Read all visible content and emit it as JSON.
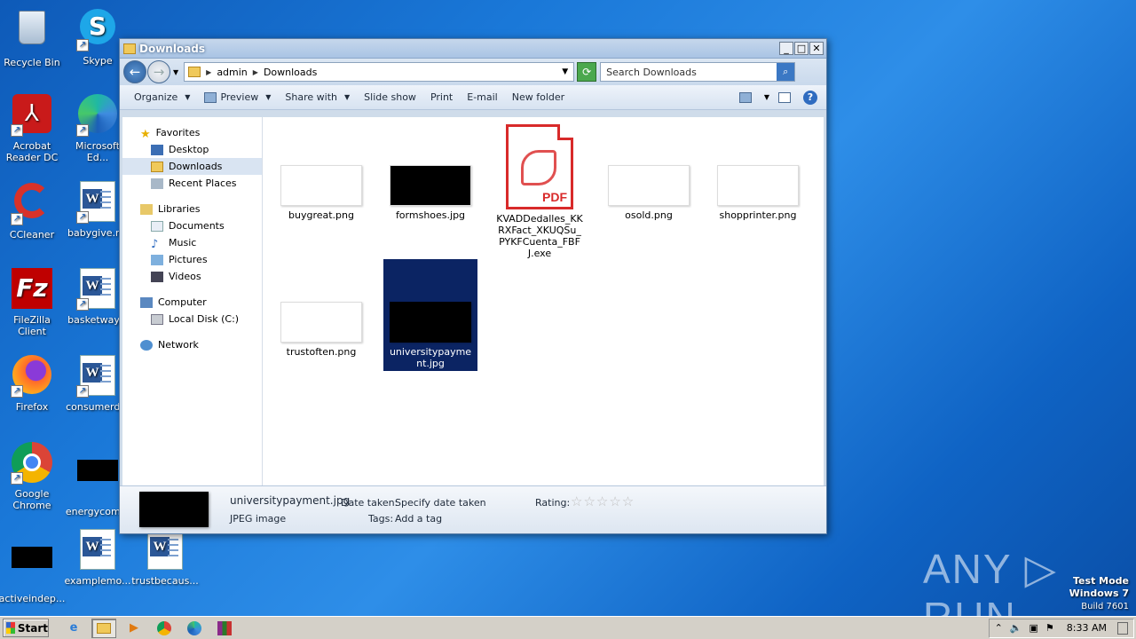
{
  "desktop": {
    "icons": [
      {
        "label": "Recycle Bin"
      },
      {
        "label": "Skype"
      },
      {
        "label": "Acrobat Reader DC"
      },
      {
        "label": "Microsoft Ed..."
      },
      {
        "label": "CCleaner"
      },
      {
        "label": "babygive.r..."
      },
      {
        "label": "FileZilla Client"
      },
      {
        "label": "basketway..."
      },
      {
        "label": "Firefox"
      },
      {
        "label": "consumerd..."
      },
      {
        "label": "Google Chrome"
      },
      {
        "label": "energycom..."
      },
      {
        "label": "activeindep..."
      },
      {
        "label": "examplemo..."
      },
      {
        "label": "trustbecaus..."
      }
    ]
  },
  "window": {
    "title": "Downloads",
    "address": {
      "crumb1": "admin",
      "crumb2": "Downloads"
    },
    "search_placeholder": "Search Downloads",
    "toolbar": {
      "organize": "Organize",
      "preview": "Preview",
      "share_with": "Share with",
      "slide_show": "Slide show",
      "print": "Print",
      "email": "E-mail",
      "new_folder": "New folder"
    },
    "nav": {
      "favorites": "Favorites",
      "desktop": "Desktop",
      "downloads": "Downloads",
      "recent": "Recent Places",
      "libraries": "Libraries",
      "documents": "Documents",
      "music": "Music",
      "pictures": "Pictures",
      "videos": "Videos",
      "computer": "Computer",
      "local_disk": "Local Disk (C:)",
      "network": "Network"
    },
    "files": [
      {
        "name": "buygreat.png"
      },
      {
        "name": "formshoes.jpg"
      },
      {
        "name": "KVADDedalles_KKRXFact_XKUQSu_PYKFCuenta_FBFJ.exe"
      },
      {
        "name": "osold.png"
      },
      {
        "name": "shopprinter.png"
      },
      {
        "name": "trustoften.png"
      },
      {
        "name": "universitypayment.jpg"
      }
    ],
    "pdf_badge": "PDF",
    "details": {
      "name": "universitypayment.jpg",
      "type": "JPEG image",
      "date_label": "Date taken:",
      "date_value": "Specify date taken",
      "tags_label": "Tags:",
      "tags_value": "Add a tag",
      "rating_label": "Rating:",
      "rating_stars": "☆☆☆☆☆"
    }
  },
  "taskbar": {
    "start": "Start",
    "time": "8:33 AM"
  },
  "watermark": {
    "line1": "Test Mode",
    "line2": "Windows 7",
    "line3": "Build 7601",
    "brand": "ANY ▷ RUN"
  }
}
